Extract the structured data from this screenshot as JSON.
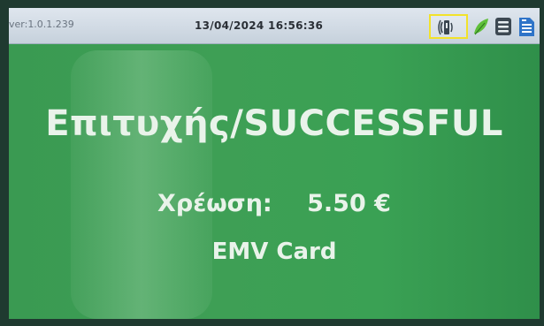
{
  "status_bar": {
    "version": "ver:1.0.1.239",
    "datetime": "13/04/2024 16:56:36",
    "icons": [
      "contactless-card-reader-icon",
      "leaf-icon",
      "menu-icon",
      "sim-card-icon"
    ],
    "highlight_color": "#f2e22a"
  },
  "result": {
    "title": "Επιτυχής/SUCCESSFUL",
    "charge_label": "Χρέωση:",
    "charge_amount": "5.50 €",
    "card_type": "EMV Card"
  },
  "colors": {
    "screen_green": "#3a9a52",
    "text": "#e9f3ea",
    "status_bar": "#dfe6ee"
  }
}
